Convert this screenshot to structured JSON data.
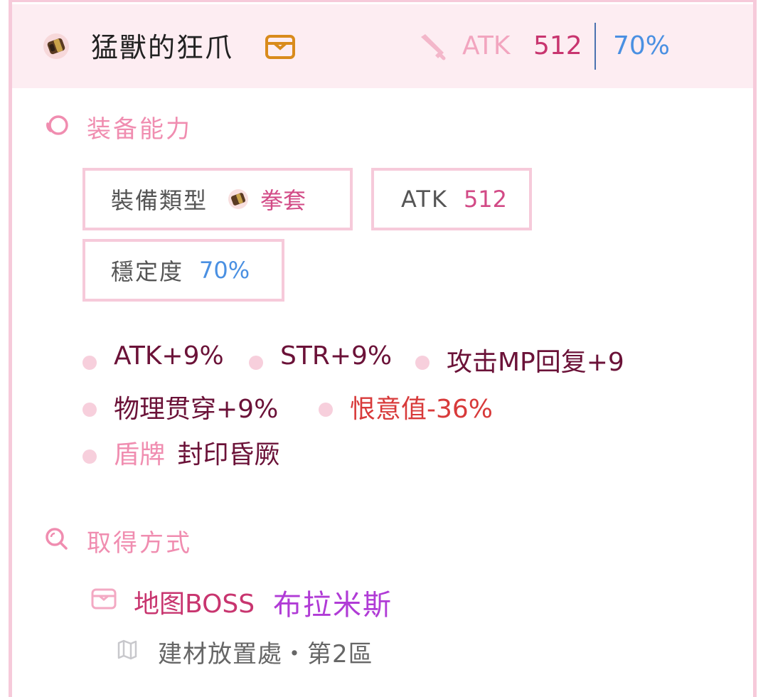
{
  "header": {
    "item_name": "猛獸的狂爪",
    "atk_label": "ATK",
    "atk_value": "512",
    "stability_value": "70%",
    "icons": [
      "gauntlet-item-icon",
      "treasure-box-icon",
      "sword-icon"
    ]
  },
  "equip_section": {
    "title": "装备能力",
    "icon": "swirl-icon",
    "type_label": "裝備類型",
    "type_value": "拳套",
    "atk_label": "ATK",
    "atk_value": "512",
    "stability_label": "穩定度",
    "stability_value": "70%"
  },
  "abilities": [
    {
      "text": "ATK+9%"
    },
    {
      "text": "STR+9%"
    },
    {
      "text": "攻击MP回复+9"
    },
    {
      "text": "物理贯穿+9%"
    },
    {
      "text": "恨意值-36%"
    },
    {
      "prefix": "盾牌",
      "text": "封印昏厥"
    }
  ],
  "acquire_section": {
    "title": "取得方式",
    "icon": "search-icon",
    "source_type": "地图BOSS",
    "source_name": "布拉米斯",
    "location": "建材放置處・第2區",
    "location_icon": "map-icon"
  },
  "colors": {
    "border": "#f6cada",
    "header_bg": "#fdedf2",
    "pink_accent": "#f08db0",
    "dark_ability": "#6b1238",
    "red_ability": "#d83a3a",
    "blue_value": "#4a90e2",
    "purple_name": "#b03bd6"
  }
}
